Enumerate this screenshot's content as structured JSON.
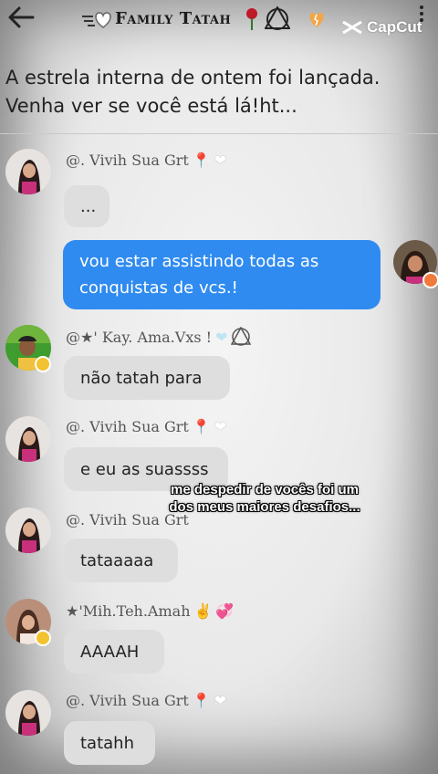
{
  "header": {
    "title": "Family Tatah",
    "watermark": "CapCut",
    "icons": [
      "back-arrow-icon",
      "white-heart-icon",
      "rose-icon",
      "triangle-circle-icon",
      "broken-heart-icon",
      "kebab-menu-icon"
    ]
  },
  "announcement": {
    "text": "A estrela interna de ontem foi lançada. Venha ver se você está lá!ht..."
  },
  "messages": [
    {
      "sender": "@. Vivih Sua Grt",
      "text": "..."
    },
    {
      "sender": "",
      "text": "vou estar assistindo todas as conquistas de vcs.!",
      "outgoing": true
    },
    {
      "sender": "@★' Kay. Ama.Vxs !",
      "text": "não tatah para"
    },
    {
      "sender": "@. Vivih Sua Grt",
      "text": "e eu as suassss"
    },
    {
      "sender": "@. Vivih Sua Grt",
      "text": "tataaaaa"
    },
    {
      "sender": "★'Mih.Teh.Amah",
      "text": "AAAAH"
    },
    {
      "sender": "@. Vivih Sua Grt",
      "text": "tatahh"
    }
  ],
  "outgoing_lines": [
    "vou estar assistindo todas as",
    "conquistas de vcs.!"
  ],
  "caption": {
    "line1": "me despedir de vocês foi um",
    "line2": "dos meus maiores desafios..."
  },
  "colors": {
    "outgoing_bubble": "#2f8bef",
    "incoming_bubble": "#dedede",
    "pin": "#e23b3b",
    "badge": "#f2c230"
  }
}
